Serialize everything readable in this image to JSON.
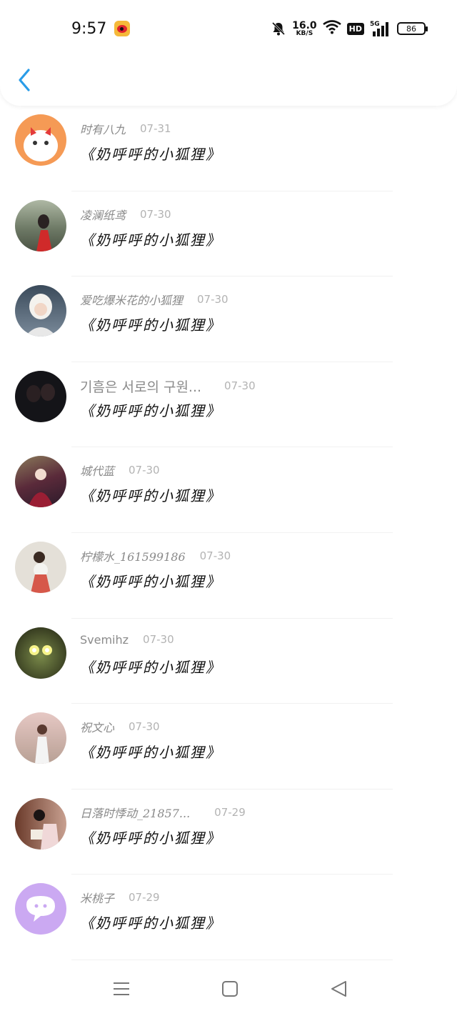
{
  "status_bar": {
    "time": "9:57",
    "net_speed_value": "16.0",
    "net_speed_unit": "KB/S",
    "hd_label": "HD",
    "signal_label": "5G",
    "battery": "86",
    "icons": [
      "weibo-icon",
      "bell-off-icon",
      "wifi-icon",
      "signal-icon",
      "battery-icon"
    ]
  },
  "header": {
    "back_icon": "chevron-left-icon",
    "accent": "#2a9ce8"
  },
  "items": [
    {
      "name": "时有八九",
      "date": "07-31",
      "title": "《奶呼呼的小狐狸》",
      "avatar_color": "#f59a55"
    },
    {
      "name": "凌澜纸鸢",
      "date": "07-30",
      "title": "《奶呼呼的小狐狸》",
      "avatar_color": "#8a9a7a"
    },
    {
      "name": "爱吃爆米花的小狐狸",
      "date": "07-30",
      "title": "《奶呼呼的小狐狸》",
      "avatar_color": "#5a6a7a"
    },
    {
      "name": "기흠은 서로의 구원...",
      "date": "07-30",
      "title": "《奶呼呼的小狐狸》",
      "avatar_color": "#1a1a1e"
    },
    {
      "name": "城代蓝",
      "date": "07-30",
      "title": "《奶呼呼的小狐狸》",
      "avatar_color": "#6a2a3a"
    },
    {
      "name": "柠檬水_161599186",
      "date": "07-30",
      "title": "《奶呼呼的小狐狸》",
      "avatar_color": "#d8d4cc"
    },
    {
      "name": "Svemihz",
      "date": "07-30",
      "title": "《奶呼呼的小狐狸》",
      "avatar_color": "#5a6a3a"
    },
    {
      "name": "祝文心",
      "date": "07-30",
      "title": "《奶呼呼的小狐狸》",
      "avatar_color": "#c8a8a0"
    },
    {
      "name": "日落时悸动_21857...",
      "date": "07-29",
      "title": "《奶呼呼的小狐狸》",
      "avatar_color": "#8a5a4a"
    },
    {
      "name": "米桃子",
      "date": "07-29",
      "title": "《奶呼呼的小狐狸》",
      "avatar_color": "#c9a8f0"
    }
  ],
  "navbar": {
    "icons": [
      "menu-icon",
      "home-square-icon",
      "back-triangle-icon"
    ]
  }
}
